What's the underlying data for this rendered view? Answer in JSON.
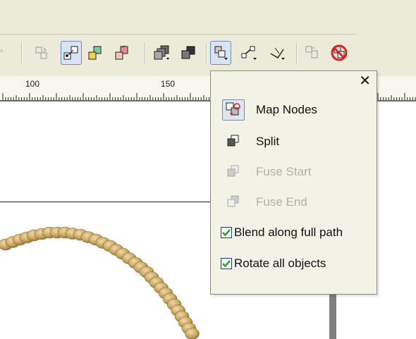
{
  "toolbar": {
    "buttons": [
      {
        "name": "transform-button",
        "icon": "transform-icon"
      },
      {
        "name": "start-object-button",
        "icon": "start-object-icon",
        "pressed": true
      },
      {
        "name": "end-object-button",
        "icon": "end-object-icon"
      },
      {
        "name": "path-properties-button",
        "icon": "path-properties-icon"
      },
      {
        "name": "copy-blend-button",
        "icon": "copy-blend-icon"
      },
      {
        "name": "clone-blend-button",
        "icon": "clone-blend-icon"
      },
      {
        "name": "more-blend-options-button",
        "icon": "more-blend-options-icon",
        "pressed": true
      },
      {
        "name": "start-end-properties-button",
        "icon": "start-end-properties-icon"
      },
      {
        "name": "path-properties-dropdown-button",
        "icon": "path-dropdown-icon"
      },
      {
        "name": "copy-properties-button",
        "icon": "copy-properties-icon"
      },
      {
        "name": "clear-blend-button",
        "icon": "clear-blend-icon"
      }
    ]
  },
  "ruler": {
    "labels": [
      "100",
      "150"
    ]
  },
  "popup": {
    "close_label": "✕",
    "items": [
      {
        "label": "Map Nodes",
        "enabled": true
      },
      {
        "label": "Split",
        "enabled": true
      },
      {
        "label": "Fuse Start",
        "enabled": false
      },
      {
        "label": "Fuse End",
        "enabled": false
      }
    ],
    "checks": [
      {
        "label": "Blend along full path",
        "checked": true
      },
      {
        "label": "Rotate all objects",
        "checked": true
      }
    ]
  },
  "colors": {
    "bead": "#c9a763",
    "bead_shadow": "#8f6d34",
    "check": "#21a121"
  }
}
